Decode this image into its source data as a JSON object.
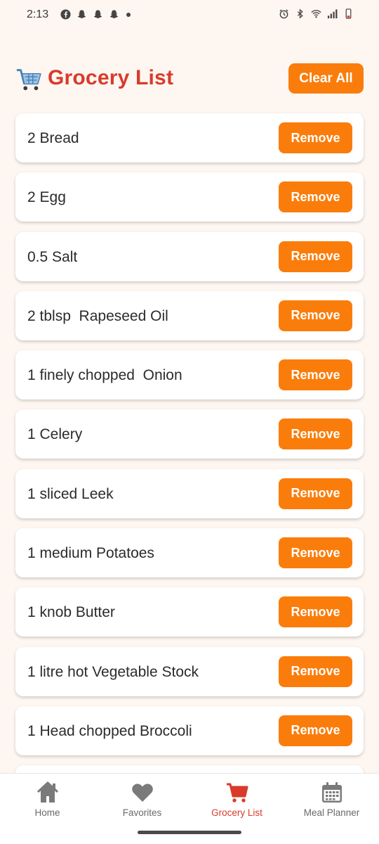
{
  "status_bar": {
    "time": "2:13",
    "left_icons": [
      "facebook-icon",
      "snapchat-icon",
      "snapchat-icon",
      "snapchat-icon",
      "notification-dot"
    ],
    "right_icons": [
      "alarm-icon",
      "bluetooth-icon",
      "wifi-icon",
      "signal-icon",
      "battery-low-icon"
    ],
    "battery_color": "#e53935"
  },
  "header": {
    "icon": "shopping-cart-icon",
    "title": "Grocery List",
    "clear_label": "Clear All"
  },
  "items": [
    {
      "text": "2 Bread",
      "remove_label": "Remove"
    },
    {
      "text": "2 Egg",
      "remove_label": "Remove"
    },
    {
      "text": "0.5 Salt",
      "remove_label": "Remove"
    },
    {
      "text": "2 tblsp  Rapeseed Oil",
      "remove_label": "Remove"
    },
    {
      "text": "1 finely chopped  Onion",
      "remove_label": "Remove"
    },
    {
      "text": "1 Celery",
      "remove_label": "Remove"
    },
    {
      "text": "1 sliced Leek",
      "remove_label": "Remove"
    },
    {
      "text": "1 medium Potatoes",
      "remove_label": "Remove"
    },
    {
      "text": "1 knob Butter",
      "remove_label": "Remove"
    },
    {
      "text": "1 litre hot Vegetable Stock",
      "remove_label": "Remove"
    },
    {
      "text": "1 Head chopped Broccoli",
      "remove_label": "Remove"
    },
    {
      "text": "",
      "remove_label": ""
    }
  ],
  "nav": [
    {
      "label": "Home",
      "icon": "home-icon",
      "active": false
    },
    {
      "label": "Favorites",
      "icon": "heart-icon",
      "active": false
    },
    {
      "label": "Grocery List",
      "icon": "shopping-cart-icon",
      "active": true
    },
    {
      "label": "Meal Planner",
      "icon": "calendar-icon",
      "active": false
    }
  ],
  "colors": {
    "accent": "#fa7d0c",
    "title": "#d93a2b",
    "background": "#fdf6f1",
    "nav_inactive": "#7a7a7a",
    "nav_active": "#d93a2b"
  }
}
